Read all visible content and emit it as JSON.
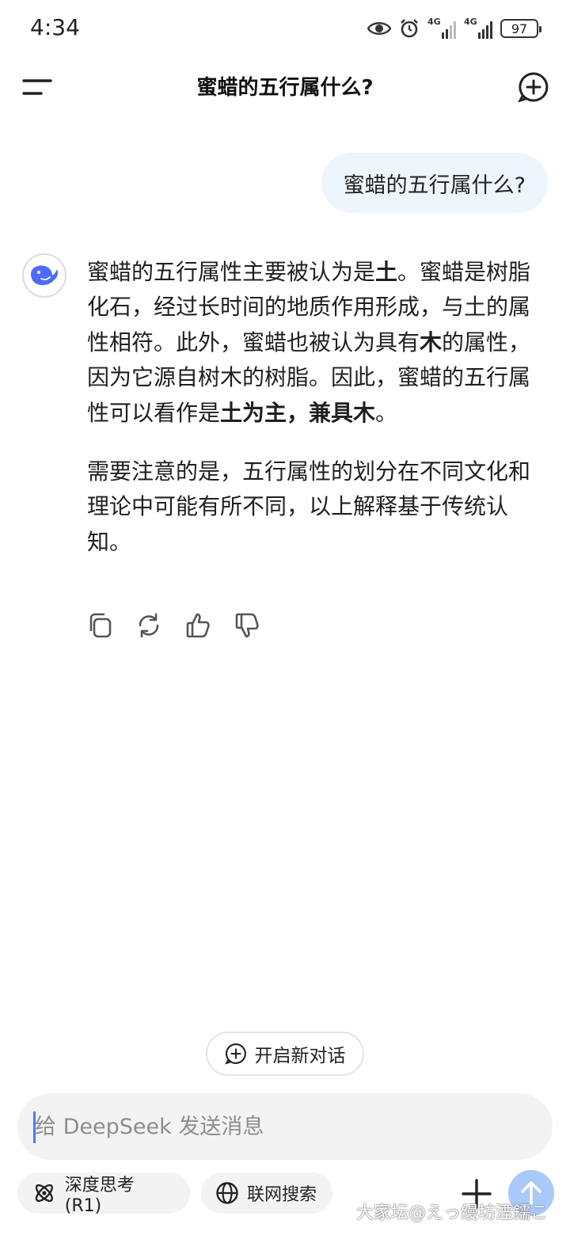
{
  "status_bar": {
    "time": "4:34",
    "network_1": "4G",
    "network_2": "4G",
    "battery": "97",
    "icons": [
      "eye-icon",
      "alarm-icon",
      "signal-icon",
      "battery-icon"
    ]
  },
  "header": {
    "title": "蜜蜡的五行属什么?",
    "icons": [
      "menu-icon",
      "new-chat-plus-icon"
    ]
  },
  "conversation": {
    "user_message": "蜜蜡的五行属什么?",
    "assistant": {
      "avatar_icon": "deepseek-whale-icon",
      "paragraph_1": [
        {
          "text": "蜜蜡的五行属性主要被认为是",
          "bold": false
        },
        {
          "text": "土",
          "bold": true
        },
        {
          "text": "。蜜蜡是树脂化石，经过长时间的地质作用形成，与土的属性相符。此外，蜜蜡也被认为具有",
          "bold": false
        },
        {
          "text": "木",
          "bold": true
        },
        {
          "text": "的属性，因为它源自树木的树脂。因此，蜜蜡的五行属性可以看作是",
          "bold": false
        },
        {
          "text": "土为主，兼具木",
          "bold": true
        },
        {
          "text": "。",
          "bold": false
        }
      ],
      "paragraph_2": "需要注意的是，五行属性的划分在不同文化和理论中可能有所不同，以上解释基于传统认知。"
    },
    "action_icons": [
      "copy-icon",
      "regenerate-icon",
      "thumbs-up-icon",
      "thumbs-down-icon"
    ]
  },
  "new_conversation_label": "开启新对话",
  "composer": {
    "placeholder": "给 DeepSeek 发送消息",
    "deep_think_label": "深度思考 (R1)",
    "web_search_label": "联网搜索",
    "icons": [
      "atom-icon",
      "globe-icon",
      "plus-icon",
      "send-arrow-icon"
    ]
  },
  "colors": {
    "user_bubble": "#eff5fd",
    "accent_blue": "#4d6bfe",
    "send_button": "#a9c8fb",
    "input_bg": "#f3f3f4"
  },
  "watermark": "大家坛@えっ缦坊湮鑐こ"
}
